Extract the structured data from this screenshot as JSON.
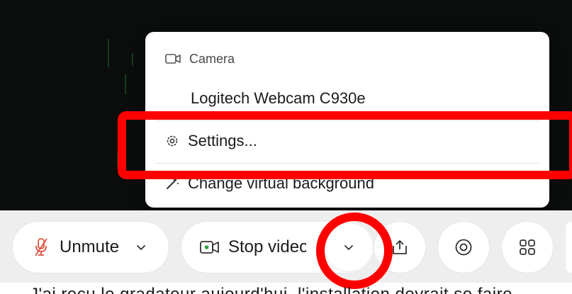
{
  "menu": {
    "section_title": "Camera",
    "device_name": "Logitech Webcam C930e",
    "settings_label": "Settings...",
    "virtual_bg_label": "Change virtual background"
  },
  "toolbar": {
    "unmute_label": "Unmute",
    "stop_video_label": "Stop video"
  },
  "caption": {
    "text": "J'ai reçu le gradateur aujourd'hui, l'installation devrait se faire"
  },
  "colors": {
    "annotation": "#ff0000",
    "mic_muted": "#e0533f",
    "video_on": "#2e9e3d"
  },
  "icons": {
    "camera": "camera-icon",
    "settings": "gear-icon",
    "virtual_bg": "magic-wand-icon",
    "mic": "mic-off-icon",
    "video": "video-camera-icon",
    "share": "share-screen-icon",
    "record": "record-icon",
    "apps": "apps-grid-icon"
  }
}
